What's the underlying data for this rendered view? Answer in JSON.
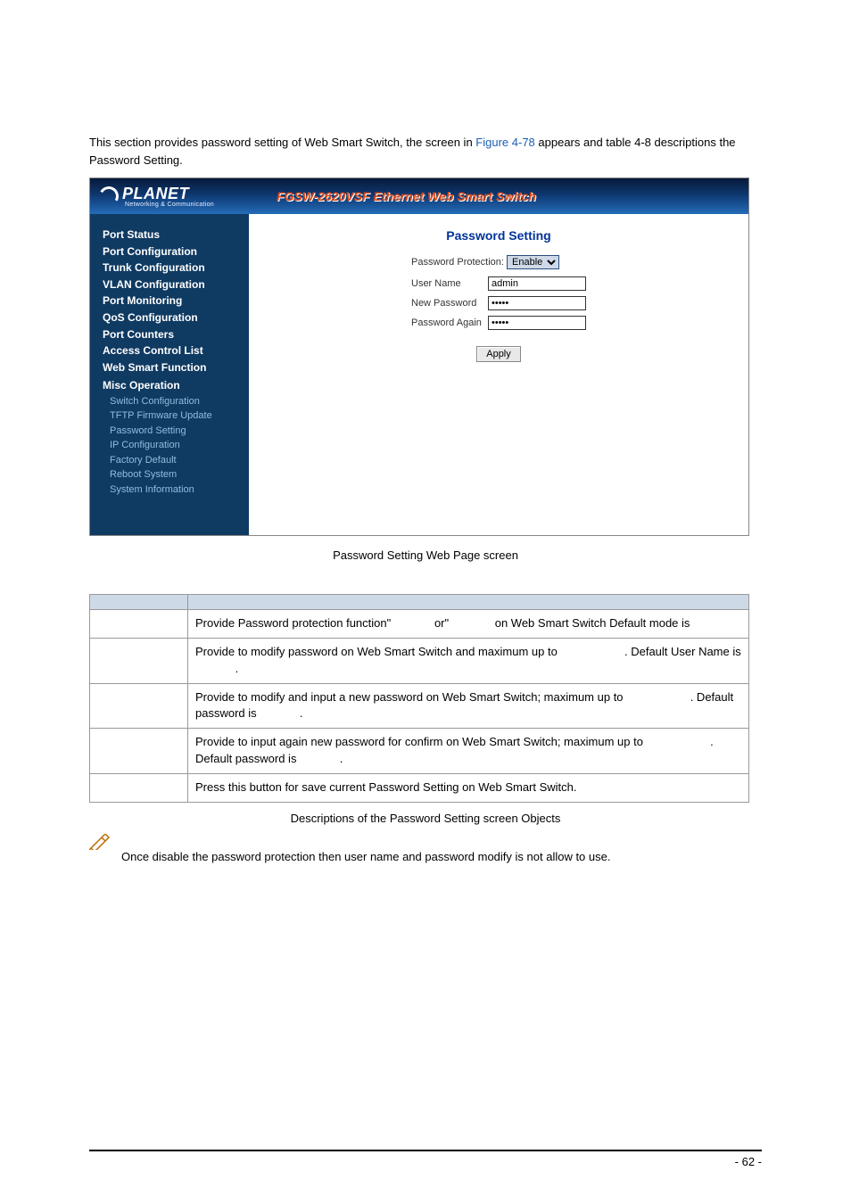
{
  "page": {
    "intro_pre": "This section provides password setting of Web Smart Switch, the screen in ",
    "intro_link": "Figure 4-78",
    "intro_post": " appears and table 4-8 descriptions the Password Setting.",
    "fig_caption": "Password Setting Web Page screen",
    "table_caption": "Descriptions of the Password Setting screen Objects",
    "note_text": "Once disable the password protection then user name and password modify is not allow to use.",
    "footer": "- 62 -"
  },
  "app": {
    "brand_name": "PLANET",
    "brand_sub": "Networking & Communication",
    "title": "FGSW-2620VSF Ethernet Web Smart Switch"
  },
  "sidebar": {
    "top": [
      "Port Status",
      "Port Configuration",
      "Trunk Configuration",
      "VLAN Configuration",
      "Port Monitoring",
      "QoS Configuration",
      "Port Counters",
      "Access Control List",
      "Web Smart Function"
    ],
    "misc_head": "Misc Operation",
    "sub": [
      "Switch Configuration",
      "TFTP Firmware Update",
      "Password Setting",
      "IP Configuration",
      "Factory Default",
      "Reboot System",
      "System Information"
    ]
  },
  "panel": {
    "title": "Password Setting",
    "protection_label": "Password Protection:",
    "protection_value": "Enable",
    "fields": {
      "username_label": "User Name",
      "username_value": "admin",
      "newpw_label": "New Password",
      "newpw_value": "*****",
      "pwagain_label": "Password Again",
      "pwagain_value": "*****"
    },
    "apply_label": "Apply"
  },
  "table": {
    "rows": [
      {
        "d1": "Provide Password protection function\"",
        "d2": " or\"",
        "d3": " on Web Smart Switch  Default mode is"
      },
      {
        "d1": "Provide to modify password on Web Smart Switch and maximum up to ",
        "d2": ". Default User Name is ",
        "d3": "."
      },
      {
        "d1": "Provide to modify and input a new password on Web Smart Switch; maximum up to ",
        "d2": ". Default password is ",
        "d3": "."
      },
      {
        "d1": "Provide to input again new password for confirm on Web Smart Switch; maximum up to ",
        "d2": ". Default password is ",
        "d3": "."
      },
      {
        "d1": "Press this button for save current Password Setting on Web Smart Switch."
      }
    ]
  }
}
